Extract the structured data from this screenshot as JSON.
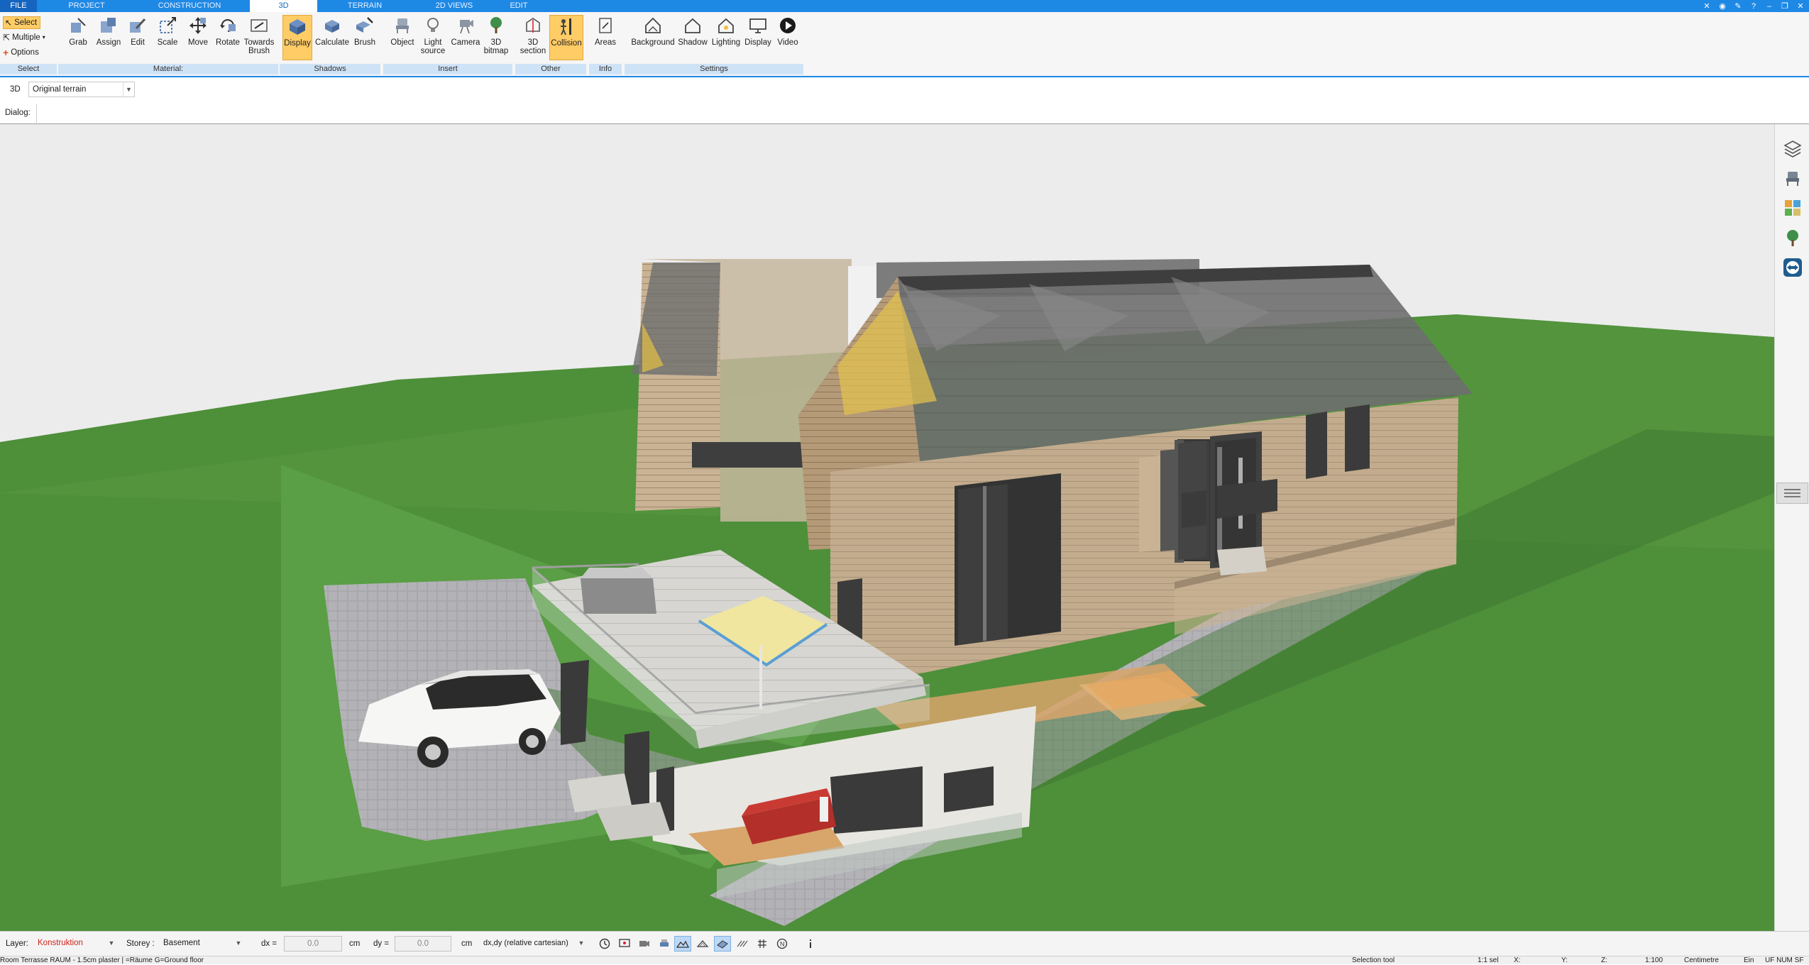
{
  "menu": {
    "tabs": [
      {
        "label": "FILE"
      },
      {
        "label": "PROJECT"
      },
      {
        "label": "CONSTRUCTION"
      },
      {
        "label": "3D"
      },
      {
        "label": "TERRAIN"
      },
      {
        "label": "2D VIEWS"
      },
      {
        "label": "EDIT"
      }
    ]
  },
  "ribbon": {
    "select": {
      "select_label": "Select",
      "multiple_label": "Multiple",
      "options_label": "Options",
      "group": "Select"
    },
    "material": {
      "buttons": [
        {
          "label": "Grab"
        },
        {
          "label": "Assign"
        },
        {
          "label": "Edit"
        },
        {
          "label": "Scale"
        },
        {
          "label": "Move"
        },
        {
          "label": "Rotate"
        },
        {
          "label": "Towards Brush"
        }
      ],
      "group": "Material:"
    },
    "shadows": {
      "buttons": [
        {
          "label": "Display"
        },
        {
          "label": "Calculate"
        },
        {
          "label": "Brush"
        }
      ],
      "group": "Shadows"
    },
    "insert": {
      "buttons": [
        {
          "label": "Object"
        },
        {
          "label": "Light source"
        },
        {
          "label": "Camera"
        },
        {
          "label": "3D bitmap"
        }
      ],
      "group": "Insert"
    },
    "other": {
      "buttons": [
        {
          "label": "3D section"
        },
        {
          "label": "Collision"
        }
      ],
      "group": "Other"
    },
    "info": {
      "buttons": [
        {
          "label": "Areas"
        }
      ],
      "group": "Info"
    },
    "settings": {
      "buttons": [
        {
          "label": "Background"
        },
        {
          "label": "Shadow"
        },
        {
          "label": "Lighting"
        },
        {
          "label": "Display"
        },
        {
          "label": "Video"
        }
      ],
      "group": "Settings"
    }
  },
  "filter": {
    "view_mode": "3D",
    "terrain_value": "Original terrain"
  },
  "dialog": {
    "label": "Dialog:"
  },
  "coords": {
    "layer_label": "Layer:",
    "layer_value": "Konstruktion",
    "storey_label": "Storey :",
    "storey_value": "Basement",
    "dx_label": "dx =",
    "dx_value": "0.0",
    "dx_unit": "cm",
    "dy_label": "dy =",
    "dy_value": "0.0",
    "dy_unit": "cm",
    "mode_value": "dx,dy (relative cartesian)"
  },
  "status": {
    "info": "Room Terrasse RAUM - 1.5cm plaster | =Räume G=Ground floor",
    "tool": "Selection tool",
    "selection": "1:1 sel",
    "x_label": "X:",
    "y_label": "Y:",
    "z_label": "Z:",
    "scale": "1:100",
    "unit": "Centimetre",
    "lang": "Ein",
    "keys": "UF NUM SF"
  },
  "colors": {
    "accent": "#1e88e5",
    "active_button": "#ffcc66",
    "grass": "#4e8f3a",
    "sky": "#ececec"
  },
  "icons": {
    "right_toolbar": [
      "layers-icon",
      "furniture-icon",
      "materials-icon",
      "tree-icon",
      "teamviewer-icon"
    ]
  }
}
